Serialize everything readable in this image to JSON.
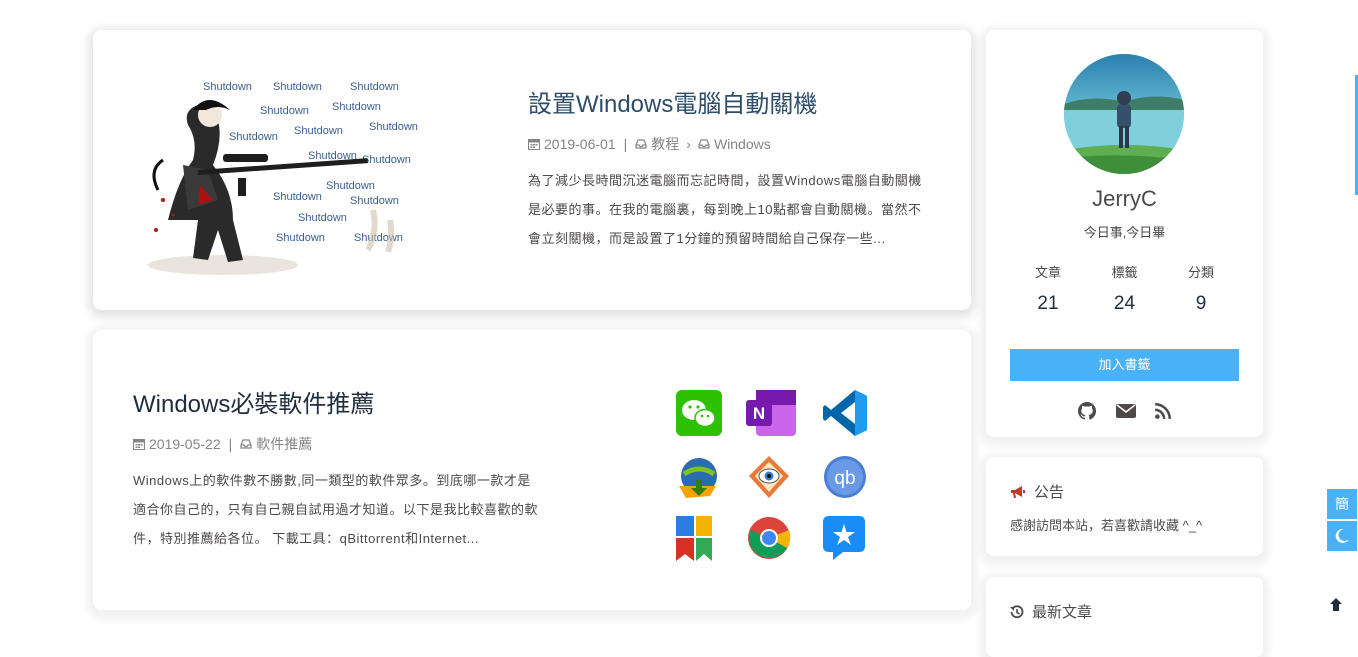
{
  "posts": [
    {
      "title": "設置Windows電腦自動關機",
      "date": "2019-06-01",
      "categories": [
        "教程",
        "Windows"
      ],
      "excerpt": "為了減少長時間沉迷電腦而忘記時間，設置Windows電腦自動關機是必要的事。在我的電腦裏，每到晚上10點都會自動關機。當然不會立刻關機，而是設置了1分鐘的預留時間給自己保存一些...",
      "cover_words": [
        "Shutdown",
        "Shutdown",
        "Shutdown",
        "Shutdown",
        "Shutdown",
        "Shutdown",
        "Shutdown",
        "Shutdown",
        "Shutdown",
        "Shutdown",
        "Shutdown",
        "Shutdown",
        "Shutdown",
        "Shutdown",
        "Shutdown",
        "Shutdown"
      ]
    },
    {
      "title": "Windows必裝軟件推薦",
      "date": "2019-05-22",
      "categories": [
        "軟件推薦"
      ],
      "excerpt": "Windows上的軟件數不勝數,同一類型的軟件眾多。到底哪一款才是適合你自己的，只有自己親自試用過才知道。以下是我比較喜歡的軟件，特別推薦給各位。 下載工具：qBittorrent和Internet...",
      "cover_icons": [
        "wechat-icon",
        "onenote-icon",
        "vscode-icon",
        "idm-icon",
        "faststone-icon",
        "qbittorrent-icon",
        "office-tool-icon",
        "chrome-icon",
        "tim-icon"
      ],
      "cover_icon_text": {
        "onenote": "N",
        "qbittorrent": "qb"
      }
    }
  ],
  "author": {
    "name": "JerryC",
    "description": "今日事,今日畢",
    "stats": [
      {
        "label": "文章",
        "value": "21"
      },
      {
        "label": "標籤",
        "value": "24"
      },
      {
        "label": "分類",
        "value": "9"
      }
    ],
    "bookmark_label": "加入書籤",
    "social_icons": [
      "github-icon",
      "email-icon",
      "rss-icon"
    ]
  },
  "announcement": {
    "title": "公告",
    "text": "感謝訪問本站，若喜歡請收藏 ^_^"
  },
  "recent": {
    "title": "最新文章"
  },
  "side_buttons": {
    "lang": "簡"
  },
  "colors": {
    "accent": "#49b1f5",
    "title": "#1f2d3d",
    "meta": "#858585",
    "announce_icon": "#c0392b"
  }
}
